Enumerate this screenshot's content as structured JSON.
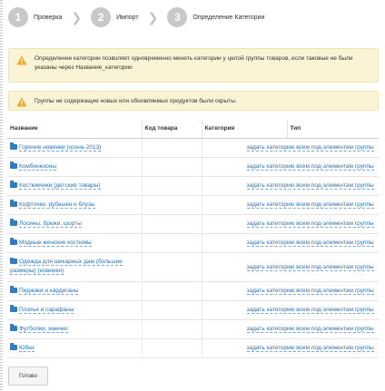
{
  "wizard": {
    "steps": [
      {
        "number": "1",
        "label": "Проверка"
      },
      {
        "number": "2",
        "label": "Импорт"
      },
      {
        "number": "3",
        "label": "Определение Категории"
      }
    ],
    "separator_icon": "chevron-right"
  },
  "alerts": [
    {
      "icon": "warning-triangle",
      "text": "Определение категории позволяет одновременно менять категории у целой группы товаров, если таковые не были указаны через Название_категории"
    },
    {
      "icon": "warning-triangle",
      "text": "Группы не содержащие новых или обновляемых продуктов были скрыты."
    }
  ],
  "table": {
    "columns": [
      "Название",
      "Код товара",
      "Категория",
      "Тип"
    ],
    "action_label": "задать категорию всем под-элементам группы",
    "rows": [
      {
        "name": "Горячие новинки (осень 2013)"
      },
      {
        "name": "Комбинезоны"
      },
      {
        "name": "Костюмчики (детские товары)"
      },
      {
        "name": "Кофточки, рубашки и блузы"
      },
      {
        "name": "Лосины, брюки, шорты"
      },
      {
        "name": "Модные женские костюмы"
      },
      {
        "name": "Одежда для шикарных дам (большие размеры) (новинки)"
      },
      {
        "name": "Пиджаки и кардиганы"
      },
      {
        "name": "Платья и сарафаны"
      },
      {
        "name": "Футболки, маечки"
      },
      {
        "name": "Юбки"
      }
    ]
  },
  "footer": {
    "done_label": "Готово"
  },
  "colors": {
    "accent": "#2a73b8",
    "alert_bg": "#fbf3d6",
    "step_circle": "#c8c8c8",
    "warning": "#f0a830"
  }
}
